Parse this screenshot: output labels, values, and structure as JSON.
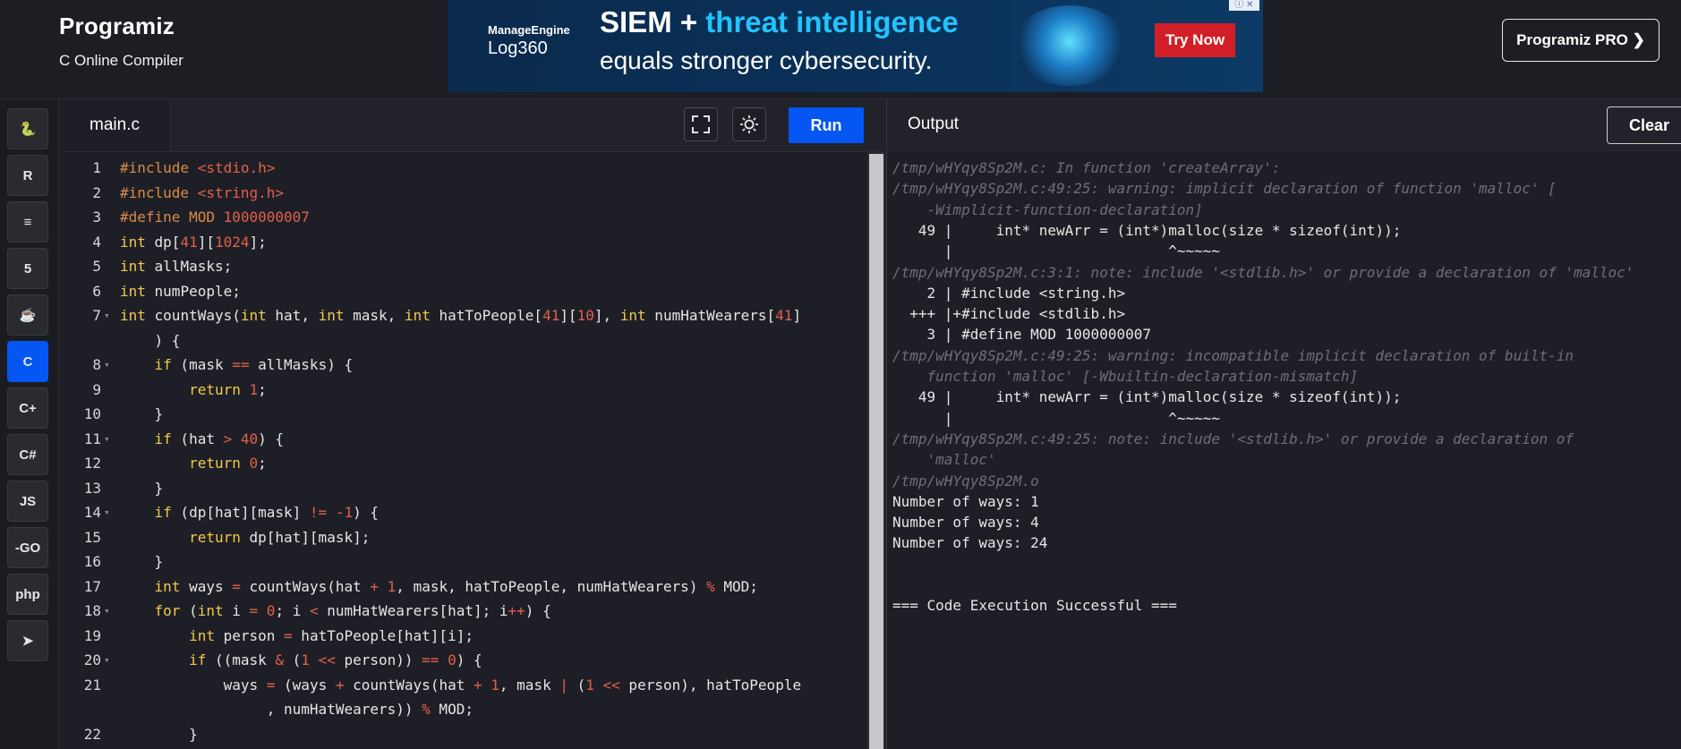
{
  "header": {
    "logo": "Programiz",
    "subtitle": "C Online Compiler",
    "pro_button": "Programiz PRO ❯"
  },
  "ad": {
    "brand_line1": "ManageEngine",
    "brand_line2": "Log360",
    "headline_part1": "SIEM + ",
    "headline_part2": "threat intelligence",
    "headline_line2": "equals stronger cybersecurity.",
    "cta": "Try Now",
    "close": "ⓘ ✕"
  },
  "languages": [
    {
      "name": "python",
      "glyph": "🐍"
    },
    {
      "name": "r",
      "glyph": "R"
    },
    {
      "name": "sql",
      "glyph": "≡"
    },
    {
      "name": "html5",
      "glyph": "5"
    },
    {
      "name": "java",
      "glyph": "☕"
    },
    {
      "name": "c",
      "glyph": "C",
      "active": true
    },
    {
      "name": "cpp",
      "glyph": "C+"
    },
    {
      "name": "csharp",
      "glyph": "C#"
    },
    {
      "name": "javascript",
      "glyph": "JS"
    },
    {
      "name": "go",
      "glyph": "-GO"
    },
    {
      "name": "php",
      "glyph": "php"
    },
    {
      "name": "swift",
      "glyph": "➤"
    }
  ],
  "editor": {
    "tab": "main.c",
    "run_label": "Run",
    "lines": [
      {
        "n": "1",
        "fold": false,
        "html": "<span class='pp'>#include</span> <span class='num'>&lt;stdio.h&gt;</span>"
      },
      {
        "n": "2",
        "fold": false,
        "html": "<span class='pp'>#include</span> <span class='num'>&lt;string.h&gt;</span>"
      },
      {
        "n": "3",
        "fold": false,
        "html": "<span class='pp'>#define MOD</span> <span class='num'>1000000007</span>"
      },
      {
        "n": "4",
        "fold": false,
        "html": "<span class='kw'>int</span> dp[<span class='num'>41</span>][<span class='num'>1024</span>];"
      },
      {
        "n": "5",
        "fold": false,
        "html": "<span class='kw'>int</span> allMasks;"
      },
      {
        "n": "6",
        "fold": false,
        "html": "<span class='kw'>int</span> numPeople;"
      },
      {
        "n": "7",
        "fold": true,
        "html": "<span class='kw'>int</span> countWays(<span class='kw'>int</span> hat, <span class='kw'>int</span> mask, <span class='kw'>int</span> hatToPeople[<span class='num'>41</span>][<span class='num'>10</span>], <span class='kw'>int</span> numHatWearers[<span class='num'>41</span>]"
      },
      {
        "n": "",
        "fold": false,
        "html": "    ) {"
      },
      {
        "n": "8",
        "fold": true,
        "html": "    <span class='kw'>if</span> (mask <span class='op'>==</span> allMasks) {"
      },
      {
        "n": "9",
        "fold": false,
        "html": "        <span class='kw'>return</span> <span class='num'>1</span>;"
      },
      {
        "n": "10",
        "fold": false,
        "html": "    }"
      },
      {
        "n": "11",
        "fold": true,
        "html": "    <span class='kw'>if</span> (hat <span class='op'>&gt;</span> <span class='num'>40</span>) {"
      },
      {
        "n": "12",
        "fold": false,
        "html": "        <span class='kw'>return</span> <span class='num'>0</span>;"
      },
      {
        "n": "13",
        "fold": false,
        "html": "    }"
      },
      {
        "n": "14",
        "fold": true,
        "html": "    <span class='kw'>if</span> (dp[hat][mask] <span class='op'>!=</span> <span class='op'>-</span><span class='num'>1</span>) {"
      },
      {
        "n": "15",
        "fold": false,
        "html": "        <span class='kw'>return</span> dp[hat][mask];"
      },
      {
        "n": "16",
        "fold": false,
        "html": "    }"
      },
      {
        "n": "17",
        "fold": false,
        "html": "    <span class='kw'>int</span> ways <span class='op'>=</span> countWays(hat <span class='op'>+</span> <span class='num'>1</span>, mask, hatToPeople, numHatWearers) <span class='op'>%</span> MOD;"
      },
      {
        "n": "18",
        "fold": true,
        "html": "    <span class='kw'>for</span> (<span class='kw'>int</span> i <span class='op'>=</span> <span class='num'>0</span>; i <span class='op'>&lt;</span> numHatWearers[hat]; i<span class='op'>++</span>) {"
      },
      {
        "n": "19",
        "fold": false,
        "html": "        <span class='kw'>int</span> person <span class='op'>=</span> hatToPeople[hat][i];"
      },
      {
        "n": "20",
        "fold": true,
        "html": "        <span class='kw'>if</span> ((mask <span class='op'>&amp;</span> (<span class='num'>1</span> <span class='op'>&lt;&lt;</span> person)) <span class='op'>==</span> <span class='num'>0</span>) {"
      },
      {
        "n": "21",
        "fold": false,
        "html": "            ways <span class='op'>=</span> (ways <span class='op'>+</span> countWays(hat <span class='op'>+</span> <span class='num'>1</span>, mask <span class='op'>|</span> (<span class='num'>1</span> <span class='op'>&lt;&lt;</span> person), hatToPeople"
      },
      {
        "n": "",
        "fold": false,
        "html": "                 , numHatWearers)) <span class='op'>%</span> MOD;"
      },
      {
        "n": "22",
        "fold": false,
        "html": "        }"
      }
    ]
  },
  "output": {
    "title": "Output",
    "clear_label": "Clear",
    "lines": [
      {
        "style": "dim",
        "text": "/tmp/wHYqy8Sp2M.c: In function 'createArray':"
      },
      {
        "style": "dim",
        "text": "/tmp/wHYqy8Sp2M.c:49:25: warning: implicit declaration of function 'malloc' ["
      },
      {
        "style": "dim",
        "text": "    -Wimplicit-function-declaration]"
      },
      {
        "style": "norm",
        "text": "   49 |     int* newArr = (int*)malloc(size * sizeof(int));"
      },
      {
        "style": "norm",
        "text": "      |                         ^~~~~~"
      },
      {
        "style": "dim",
        "text": "/tmp/wHYqy8Sp2M.c:3:1: note: include '<stdlib.h>' or provide a declaration of 'malloc'"
      },
      {
        "style": "norm",
        "text": "    2 | #include <string.h>"
      },
      {
        "style": "norm",
        "text": "  +++ |+#include <stdlib.h>"
      },
      {
        "style": "norm",
        "text": "    3 | #define MOD 1000000007"
      },
      {
        "style": "dim",
        "text": "/tmp/wHYqy8Sp2M.c:49:25: warning: incompatible implicit declaration of built-in"
      },
      {
        "style": "dim",
        "text": "    function 'malloc' [-Wbuiltin-declaration-mismatch]"
      },
      {
        "style": "norm",
        "text": "   49 |     int* newArr = (int*)malloc(size * sizeof(int));"
      },
      {
        "style": "norm",
        "text": "      |                         ^~~~~~"
      },
      {
        "style": "dim",
        "text": "/tmp/wHYqy8Sp2M.c:49:25: note: include '<stdlib.h>' or provide a declaration of"
      },
      {
        "style": "dim",
        "text": "    'malloc'"
      },
      {
        "style": "dim",
        "text": "/tmp/wHYqy8Sp2M.o"
      },
      {
        "style": "norm",
        "text": "Number of ways: 1"
      },
      {
        "style": "norm",
        "text": "Number of ways: 4"
      },
      {
        "style": "norm",
        "text": "Number of ways: 24"
      },
      {
        "style": "norm",
        "text": ""
      },
      {
        "style": "norm",
        "text": ""
      },
      {
        "style": "norm",
        "text": "=== Code Execution Successful ==="
      }
    ]
  }
}
